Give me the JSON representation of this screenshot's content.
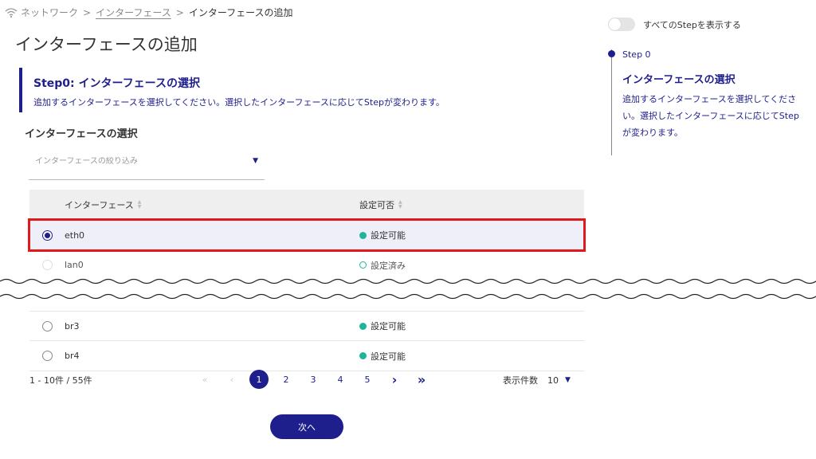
{
  "breadcrumb": {
    "items": [
      "ネットワーク",
      "インターフェース"
    ],
    "current": "インターフェースの追加",
    "separator": ">"
  },
  "page": {
    "title": "インターフェースの追加"
  },
  "step": {
    "title": "Step0: インターフェースの選択",
    "description": "追加するインターフェースを選択してください。選択したインターフェースに応じてStepが変わります。"
  },
  "section": {
    "label": "インターフェースの選択"
  },
  "filter": {
    "placeholder": "インターフェースの絞り込み",
    "value": ""
  },
  "table": {
    "columns": [
      "インターフェース",
      "設定可否"
    ],
    "rows": [
      {
        "name": "eth0",
        "status": "設定可能",
        "selected": true,
        "disabled": false
      },
      {
        "name": "lan0",
        "status": "設定済み",
        "selected": false,
        "disabled": true
      },
      {
        "name": "br3",
        "status": "設定可能",
        "selected": false,
        "disabled": false
      },
      {
        "name": "br4",
        "status": "設定可能",
        "selected": false,
        "disabled": false
      }
    ]
  },
  "pagination": {
    "info": "1 - 10件 / 55件",
    "first": "«",
    "prev": "‹",
    "pages": [
      "1",
      "2",
      "3",
      "4",
      "5"
    ],
    "current_page": "1",
    "next": "›",
    "last": "»",
    "per_page_label": "表示件数",
    "per_page_value": "10"
  },
  "actions": {
    "next_label": "次へ"
  },
  "sidebar": {
    "toggle_label": "すべてのStepを表示する",
    "toggle_on": false,
    "step_label": "Step 0",
    "step_title": "インターフェースの選択",
    "step_description": "追加するインターフェースを選択してください。選択したインターフェースに応じてStepが変わります。"
  },
  "colors": {
    "primary": "#1e1e8c",
    "status_ok": "#1fb59a",
    "highlight": "#e01a1a",
    "selected_row_bg": "#efeff9"
  }
}
